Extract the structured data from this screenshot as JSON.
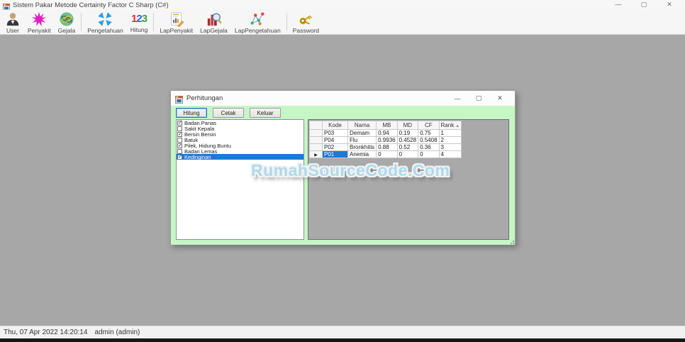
{
  "window": {
    "title": "Sistem Pakar Metode Certainty Factor C Sharp (C#)",
    "controls": {
      "minimize": "—",
      "maximize": "▢",
      "close": "✕"
    }
  },
  "toolbar": {
    "groups": [
      [
        {
          "label": "User",
          "icon": "user-icon"
        },
        {
          "label": "Penyakit",
          "icon": "virus-icon"
        },
        {
          "label": "Gejala",
          "icon": "atom-icon"
        }
      ],
      [
        {
          "label": "Pengetahuan",
          "icon": "collapse-arrows-icon"
        },
        {
          "label": "Hitung",
          "icon": "numbers-123-icon"
        }
      ],
      [
        {
          "label": "LapPenyakit",
          "icon": "report-pencil-icon"
        },
        {
          "label": "LapGejala",
          "icon": "chart-magnifier-icon"
        },
        {
          "label": "LapPengetahuan",
          "icon": "network-graph-icon"
        }
      ],
      [
        {
          "label": "Password",
          "icon": "keys-icon"
        }
      ]
    ]
  },
  "dialog": {
    "title": "Perhitungan",
    "controls": {
      "minimize": "—",
      "maximize": "▢",
      "close": "✕"
    },
    "buttons": [
      "Hitung",
      "Cetak",
      "Keluar"
    ],
    "checklist": [
      {
        "label": "Badan Panas",
        "checked": true,
        "selected": false
      },
      {
        "label": "Sakit Kepala",
        "checked": false,
        "selected": false
      },
      {
        "label": "Bersin Bersin",
        "checked": true,
        "selected": false
      },
      {
        "label": "Batuk",
        "checked": false,
        "selected": false
      },
      {
        "label": "Pilek, Hidung Buntu",
        "checked": true,
        "selected": false
      },
      {
        "label": "Badan Lemas",
        "checked": false,
        "selected": false
      },
      {
        "label": "Kedinginan",
        "checked": true,
        "selected": true
      }
    ],
    "grid": {
      "columns": [
        "Kode",
        "Nama",
        "MB",
        "MD",
        "CF",
        "Rank"
      ],
      "sort_column": "Rank",
      "rows": [
        [
          "P03",
          "Demam",
          "0.94",
          "0.19",
          "0.75",
          "1"
        ],
        [
          "P04",
          "Flu",
          "0.9936",
          "0.4528",
          "0.5408",
          "2"
        ],
        [
          "P02",
          "Bronkhitis",
          "0.88",
          "0.52",
          "0.36",
          "3"
        ],
        [
          "P01",
          "Anemia",
          "0",
          "0",
          "0",
          "4"
        ]
      ],
      "selected_row": 3
    }
  },
  "watermark": "RumahSourceCode.Com",
  "statusbar": {
    "datetime": "Thu, 07 Apr 2022 14:20:14",
    "user": "admin (admin)"
  },
  "glyphs": {
    "check": "✓",
    "sort_asc": "▲",
    "row_pointer": "▶"
  },
  "colors": {
    "dialog_background": "#c6f6c5",
    "selection_blue": "#1e78d7",
    "desktop_gray": "#a7a7a7",
    "watermark_blue": "#aed9ec"
  }
}
